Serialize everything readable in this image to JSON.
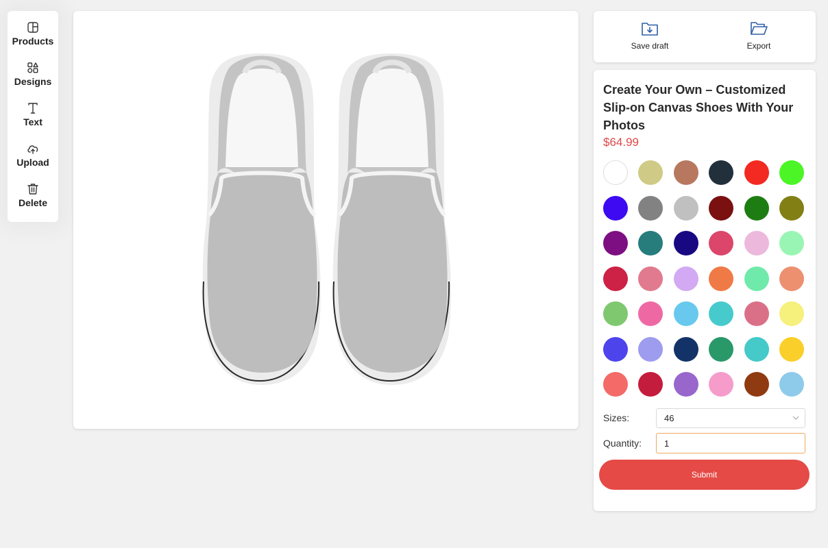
{
  "toolbar": {
    "items": [
      {
        "label": "Products",
        "icon": "products-icon"
      },
      {
        "label": "Designs",
        "icon": "designs-icon"
      },
      {
        "label": "Text",
        "icon": "text-icon"
      },
      {
        "label": "Upload",
        "icon": "upload-icon"
      },
      {
        "label": "Delete",
        "icon": "trash-icon"
      }
    ]
  },
  "actions": {
    "save_draft": "Save draft",
    "export": "Export",
    "icon_color": "#2f5ea8"
  },
  "product": {
    "title": "Create Your Own – Customized Slip-on Canvas Shoes With Your Photos",
    "price": "$64.99",
    "price_color": "#e04848"
  },
  "colors": [
    "#ffffff",
    "#cfcb86",
    "#b87860",
    "#22303c",
    "#f22a22",
    "#4cf526",
    "#3e0af2",
    "#828282",
    "#c0c0c0",
    "#7a1010",
    "#1e7d12",
    "#827f14",
    "#7e0f82",
    "#277c7c",
    "#180882",
    "#dc466a",
    "#ecb8dc",
    "#99f5b3",
    "#cd2145",
    "#e17a8e",
    "#d2a9f2",
    "#f07a46",
    "#70eaaa",
    "#ec9070",
    "#7fc870",
    "#ee69a4",
    "#68c8ee",
    "#47cacc",
    "#da7088",
    "#f6f07c",
    "#4d44ec",
    "#9e9cee",
    "#133368",
    "#2a996a",
    "#45c9c9",
    "#fbcf2a",
    "#f36a68",
    "#c41c3c",
    "#9966cc",
    "#f59ccb",
    "#8f3a11",
    "#8ecaea"
  ],
  "form": {
    "sizes_label": "Sizes:",
    "size_value": "46",
    "quantity_label": "Quantity:",
    "quantity_value": "1",
    "submit_label": "Submit",
    "submit_color": "#e54a46"
  }
}
